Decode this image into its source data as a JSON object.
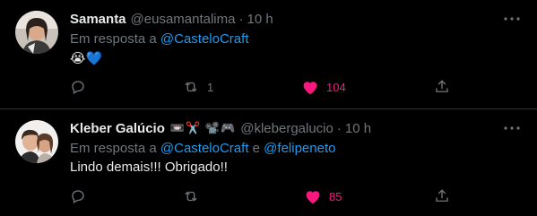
{
  "tweets": [
    {
      "name": "Samanta",
      "name_emojis": "",
      "handle": "@eusamantalima",
      "dot": "·",
      "time": "10 h",
      "replying_prefix": "Em resposta a",
      "mentions": [
        "@CasteloCraft"
      ],
      "joiner": "",
      "content": "😭💙",
      "reply_count": "",
      "retweet_count": "1",
      "like_count": "104"
    },
    {
      "name": "Kleber Galúcio",
      "name_emojis": "📼✂️ 📽️🎮",
      "handle": "@klebergalucio",
      "dot": "·",
      "time": "10 h",
      "replying_prefix": "Em resposta a",
      "mentions": [
        "@CasteloCraft",
        "@felipeneto"
      ],
      "joiner": "e",
      "content": "Lindo demais!!! Obrigado!!",
      "reply_count": "",
      "retweet_count": "",
      "like_count": "85"
    }
  ],
  "colors": {
    "background": "#000000",
    "text": "#e7e9ea",
    "muted": "#71767b",
    "link": "#1d9bf0",
    "like": "#f91880",
    "divider": "#2f3336"
  },
  "icons": [
    "more-icon",
    "reply-icon",
    "retweet-icon",
    "like-icon",
    "share-icon"
  ]
}
